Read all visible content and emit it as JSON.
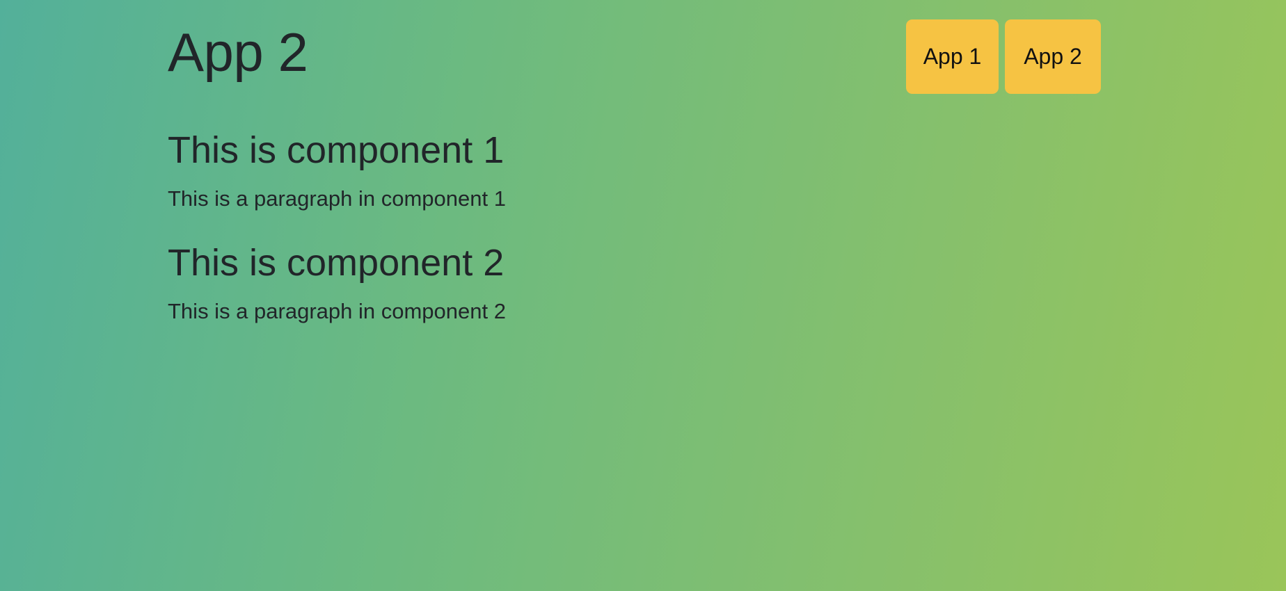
{
  "app": {
    "title": "App 2"
  },
  "nav": {
    "buttons": [
      {
        "label": "App 1"
      },
      {
        "label": "App 2"
      }
    ]
  },
  "components": [
    {
      "heading": "This is component 1",
      "paragraph": "This is a paragraph in component 1"
    },
    {
      "heading": "This is component 2",
      "paragraph": "This is a paragraph in component 2"
    }
  ],
  "colors": {
    "background_start": "#53b09a",
    "background_end": "#9ac559",
    "button": "#f6c343",
    "text": "#212529"
  }
}
